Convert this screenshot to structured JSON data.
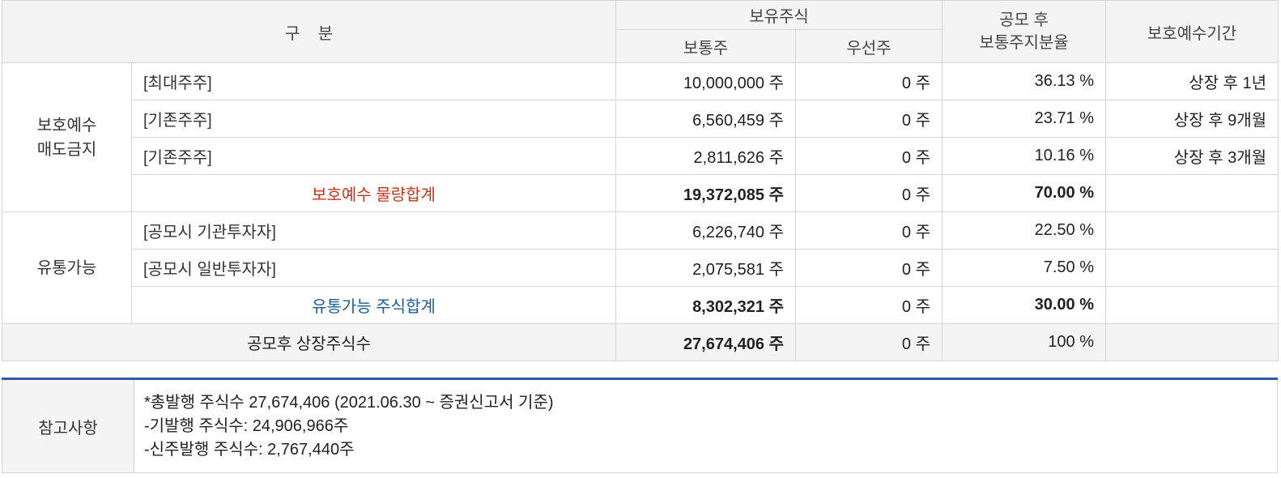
{
  "header": {
    "category": "구    분",
    "holdings": "보유주식",
    "common": "보통주",
    "preferred": "우선주",
    "ratio_line1": "공모 후",
    "ratio_line2": "보통주지분율",
    "lockup_period": "보호예수기간"
  },
  "groups": {
    "lockup_line1": "보호예수",
    "lockup_line2": "매도금지",
    "tradable": "유통가능"
  },
  "rows": [
    {
      "label": "[최대주주]",
      "common": "10,000,000 주",
      "preferred": "0 주",
      "ratio": "36.13 %",
      "period": "상장 후 1년"
    },
    {
      "label": "[기존주주]",
      "common": "6,560,459 주",
      "preferred": "0 주",
      "ratio": "23.71 %",
      "period": "상장 후 9개월"
    },
    {
      "label": "[기존주주]",
      "common": "2,811,626 주",
      "preferred": "0 주",
      "ratio": "10.16 %",
      "period": "상장 후 3개월"
    },
    {
      "label": "보호예수 물량합계",
      "common": "19,372,085 주",
      "preferred": "0 주",
      "ratio": "70.00 %",
      "period": ""
    },
    {
      "label": "[공모시 기관투자자]",
      "common": "6,226,740 주",
      "preferred": "0 주",
      "ratio": "22.50 %",
      "period": ""
    },
    {
      "label": "[공모시 일반투자자]",
      "common": "2,075,581 주",
      "preferred": "0 주",
      "ratio": "7.50 %",
      "period": ""
    },
    {
      "label": "유통가능 주식합계",
      "common": "8,302,321 주",
      "preferred": "0 주",
      "ratio": "30.00 %",
      "period": ""
    }
  ],
  "total": {
    "label": "공모후 상장주식수",
    "common": "27,674,406 주",
    "preferred": "0 주",
    "ratio": "100 %"
  },
  "notes": {
    "label": "참고사항",
    "lines": [
      "*총발행 주식수 27,674,406 (2021.06.30 ~ 증권신고서 기준)",
      "-기발행 주식수: 24,906,966주",
      "-신주발행 주식수: 2,767,440주"
    ]
  },
  "colors": {
    "lockup_total": "#c83218",
    "tradable_total": "#1a5e96",
    "header_bg": "#f4f4f4",
    "notes_border": "#2d5ba5"
  }
}
